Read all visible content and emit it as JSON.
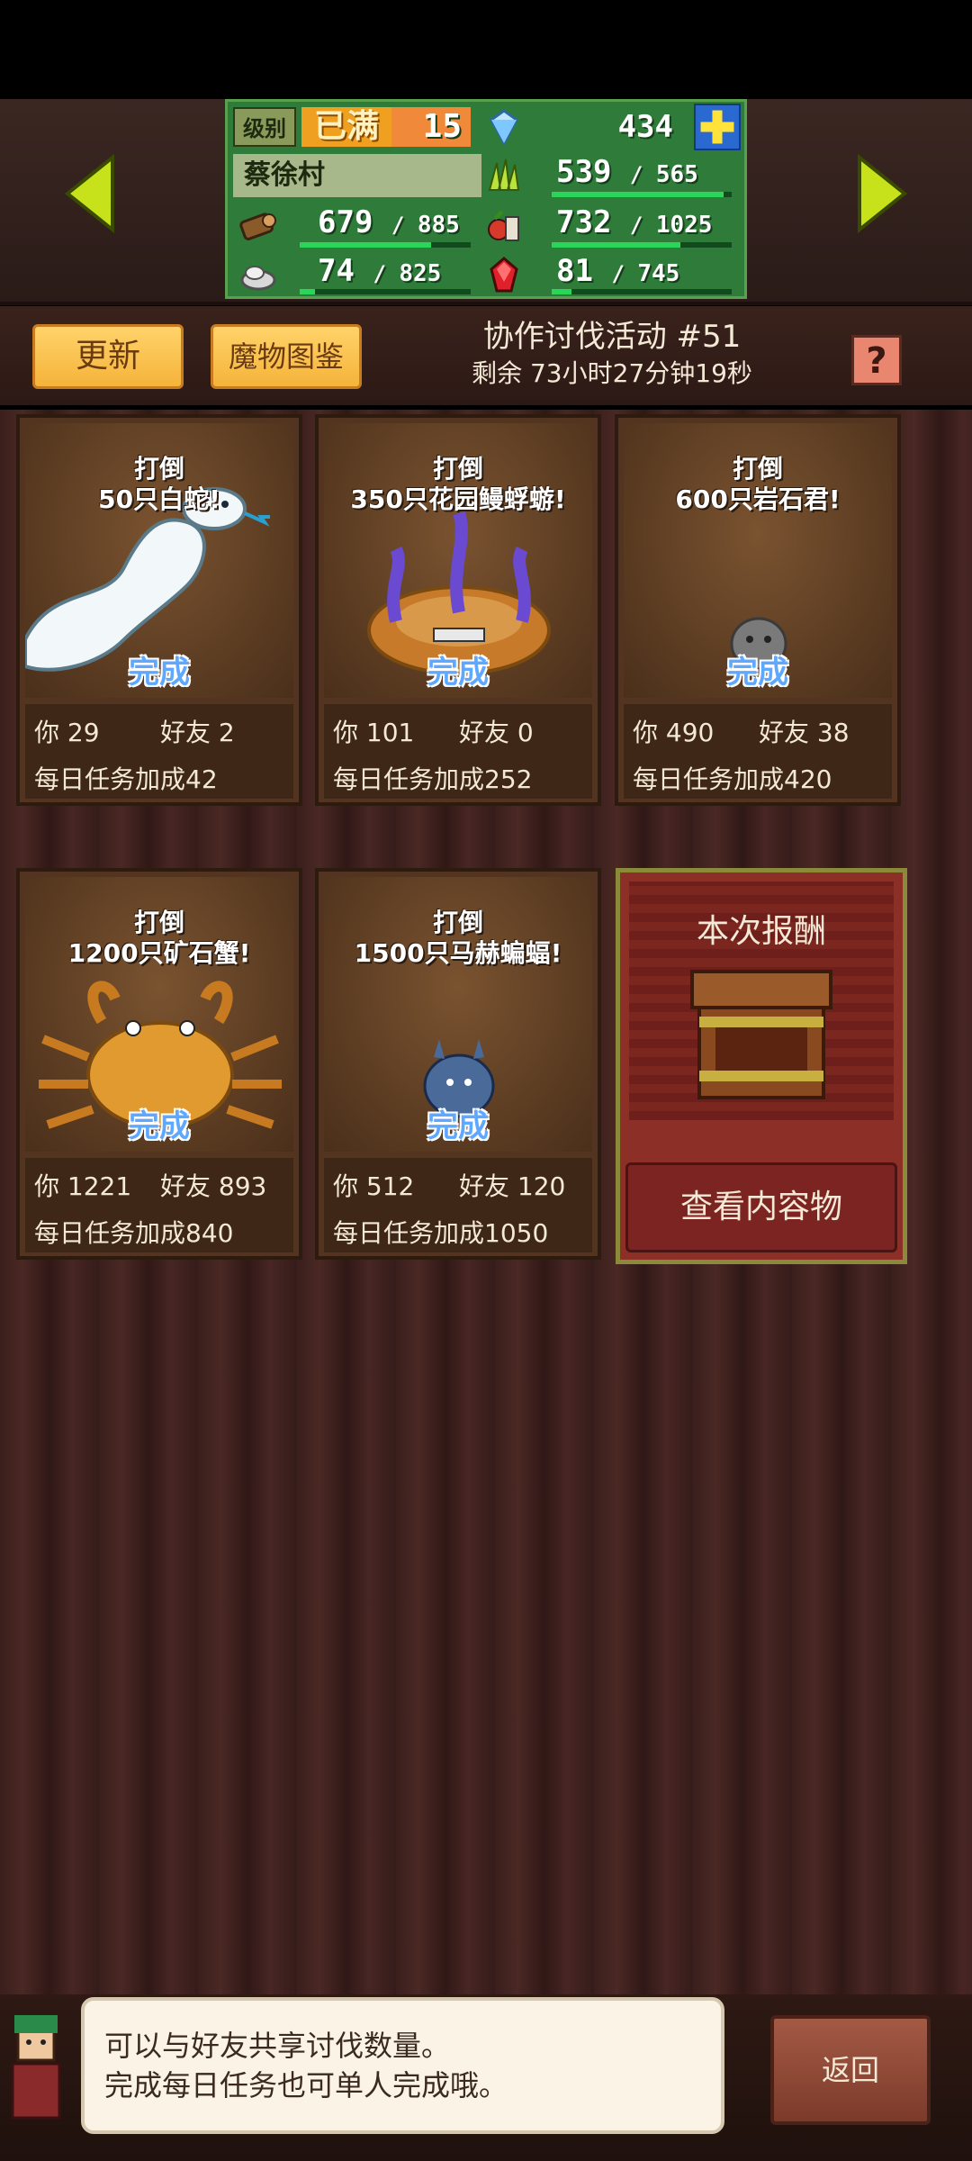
{
  "header": {
    "level_label": "级别",
    "level_status": "已满",
    "level_value": "15",
    "gems": "434",
    "town_name": "蔡徐村",
    "grass": {
      "current": "539",
      "max": "565",
      "fill": 0.954
    },
    "wood": {
      "current": "679",
      "max": "885",
      "fill": 0.767
    },
    "food": {
      "current": "732",
      "max": "1025",
      "fill": 0.714
    },
    "stone": {
      "current": "74",
      "max": "825",
      "fill": 0.09
    },
    "ruby": {
      "current": "81",
      "max": "745",
      "fill": 0.109
    }
  },
  "toolbar": {
    "refresh": "更新",
    "bestiary": "魔物图鉴",
    "event_title": "协作讨伐活动 #51",
    "time_left": "剩余 73小时27分钟19秒",
    "help": "?"
  },
  "labels": {
    "defeat": "打倒",
    "done": "完成",
    "you": "你",
    "friend": "好友",
    "daily_bonus": "每日任务加成"
  },
  "quests": [
    {
      "target": "50只白蛇!",
      "you": "29",
      "friend": "2",
      "bonus": "42"
    },
    {
      "target": "350只花园鳗蜉蝣!",
      "you": "101",
      "friend": "0",
      "bonus": "252"
    },
    {
      "target": "600只岩石君!",
      "you": "490",
      "friend": "38",
      "bonus": "420"
    },
    {
      "target": "1200只矿石蟹!",
      "you": "1221",
      "friend": "893",
      "bonus": "840"
    },
    {
      "target": "1500只马赫蝙蝠!",
      "you": "512",
      "friend": "120",
      "bonus": "1050"
    }
  ],
  "reward": {
    "title": "本次报酬",
    "button": "查看内容物"
  },
  "dialog": {
    "line1": "可以与好友共享讨伐数量。",
    "line2": "完成每日任务也可单人完成哦。"
  },
  "back": "返回",
  "colors": {
    "accent_green": "#2ad55a",
    "done_blue": "#5ea8ff",
    "button_yellow": "#ffd36a"
  }
}
